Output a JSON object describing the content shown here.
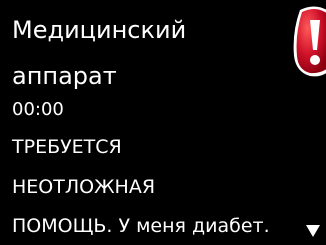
{
  "alert": {
    "title_line1": "Медицинский",
    "title_line2": "аппарат",
    "time": "00:00",
    "message_line1": "ТРЕБУЕТСЯ",
    "message_line2": "НЕОТЛОЖНАЯ",
    "message_line3": "ПОМОЩЬ. У меня диабет."
  },
  "icons": {
    "alert_icon": "exclamation-alert-icon",
    "scroll_indicator": "scroll-down-arrow-icon"
  },
  "colors": {
    "background": "#000000",
    "text": "#ffffff",
    "alert_red": "#c8102e"
  }
}
